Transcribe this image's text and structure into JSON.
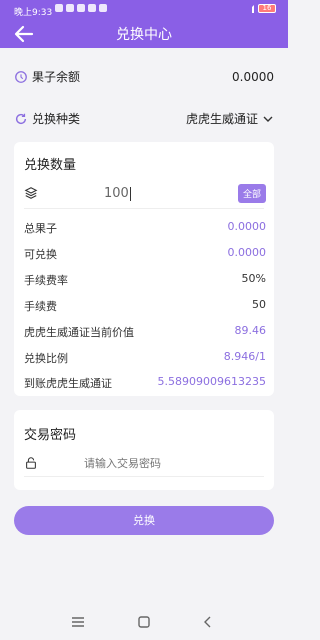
{
  "status_bar": {
    "time": "晚上9:33",
    "battery": "16"
  },
  "header": {
    "title": "兑换中心",
    "back_icon": "arrow-left-icon"
  },
  "balance": {
    "label": "果子余额",
    "value": "0.0000",
    "icon": "gear-circle-icon"
  },
  "exchange_type": {
    "label": "兑换种类",
    "value": "虎虎生威通证",
    "icon": "refresh-icon"
  },
  "amount_card": {
    "title": "兑换数量",
    "amount": "100",
    "all_button": "全部",
    "rows": [
      {
        "k": "总果子",
        "v": "0.0000",
        "purple": true
      },
      {
        "k": "可兑换",
        "v": "0.0000",
        "purple": true
      },
      {
        "k": "手续费率",
        "v": "50%",
        "purple": false
      },
      {
        "k": "手续费",
        "v": "50",
        "purple": false
      },
      {
        "k": "虎虎生威通证当前价值",
        "v": "89.46",
        "purple": true
      },
      {
        "k": "兑换比例",
        "v": "8.946/1",
        "purple": true
      },
      {
        "k": "到账虎虎生威通证",
        "v": "5.58909009613235",
        "purple": true
      }
    ]
  },
  "password_card": {
    "title": "交易密码",
    "placeholder": "请输入交易密码"
  },
  "submit": {
    "label": "兑换"
  },
  "colors": {
    "accent": "#8a5fe6",
    "button": "#9a7be9",
    "value_purple": "#8c6fe0"
  }
}
